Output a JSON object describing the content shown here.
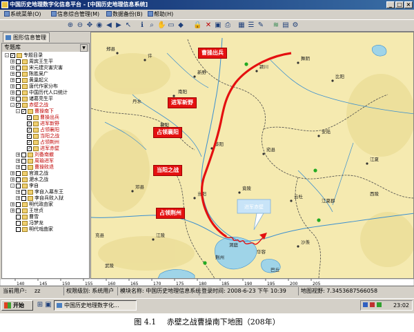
{
  "window": {
    "title": "中国历史地理数字化信息平台 - [中国历史地理信息系统]",
    "controls": [
      "_",
      "□",
      "×"
    ]
  },
  "menubar": {
    "items": [
      "系统菜单(O)",
      "信息综合管理(M)",
      "数据备份(B)",
      "帮助(H)"
    ]
  },
  "toolbar": {
    "icons": [
      "zoom-in-icon",
      "zoom-out-icon",
      "pan-icon",
      "globe-icon",
      "back-icon",
      "forward-icon",
      "pointer-icon",
      "identify-icon",
      "measure-icon",
      "hand-icon",
      "rectangle-icon",
      "color-icon",
      "delete-icon",
      "save-icon",
      "print-icon",
      "table-icon",
      "list-icon",
      "edit-icon",
      "layers-icon",
      "grid-icon",
      "settings-icon"
    ]
  },
  "tabbar": {
    "active_tab": "图形信息管理"
  },
  "panel": {
    "header": "专题库",
    "tree": [
      {
        "level": 0,
        "label": "专题目录",
        "expand": "-",
        "check": true,
        "red": false
      },
      {
        "level": 1,
        "label": "周宾王生平",
        "expand": "+",
        "check": false,
        "red": false
      },
      {
        "level": 1,
        "label": "宋元建灾害灾害",
        "expand": "+",
        "check": false,
        "red": false
      },
      {
        "level": 1,
        "label": "陈胜吴广",
        "expand": "+",
        "check": false,
        "red": false
      },
      {
        "level": 1,
        "label": "黄巢起义",
        "expand": "+",
        "check": false,
        "red": false
      },
      {
        "level": 1,
        "label": "唐代作家分布",
        "expand": "+",
        "check": false,
        "red": false
      },
      {
        "level": 1,
        "label": "中国历代人口统计",
        "expand": "+",
        "check": false,
        "red": false
      },
      {
        "level": 1,
        "label": "诸葛亮生平",
        "expand": "+",
        "check": false,
        "red": false
      },
      {
        "level": 1,
        "label": "赤壁之战",
        "expand": "-",
        "check": true,
        "red": true
      },
      {
        "level": 2,
        "label": "曹操南下",
        "expand": "-",
        "check": true,
        "red": true
      },
      {
        "level": 3,
        "label": "曹操出兵",
        "expand": "",
        "check": true,
        "red": true
      },
      {
        "level": 3,
        "label": "进军新野",
        "expand": "",
        "check": true,
        "red": true
      },
      {
        "level": 3,
        "label": "占领襄阳",
        "expand": "",
        "check": true,
        "red": true
      },
      {
        "level": 3,
        "label": "当阳之战",
        "expand": "",
        "check": true,
        "red": true
      },
      {
        "level": 3,
        "label": "占领荆州",
        "expand": "",
        "check": true,
        "red": true
      },
      {
        "level": 3,
        "label": "进军赤壁",
        "expand": "",
        "check": true,
        "red": true
      },
      {
        "level": 2,
        "label": "刘备南撤",
        "expand": "+",
        "check": false,
        "red": true
      },
      {
        "level": 2,
        "label": "周瑜进军",
        "expand": "+",
        "check": false,
        "red": true
      },
      {
        "level": 2,
        "label": "曹操败退",
        "expand": "+",
        "check": false,
        "red": true
      },
      {
        "level": 1,
        "label": "官渡之战",
        "expand": "+",
        "check": false,
        "red": false
      },
      {
        "level": 1,
        "label": "淝水之战",
        "expand": "+",
        "check": false,
        "red": false
      },
      {
        "level": 1,
        "label": "李自",
        "expand": "-",
        "check": false,
        "red": false
      },
      {
        "level": 2,
        "label": "李自入幕东王",
        "expand": "+",
        "check": false,
        "red": false
      },
      {
        "level": 2,
        "label": "李自兵败入狱",
        "expand": "+",
        "check": false,
        "red": false
      },
      {
        "level": 1,
        "label": "明代政由家",
        "expand": "+",
        "check": false,
        "red": false
      },
      {
        "level": 1,
        "label": "王世贞",
        "expand": "+",
        "check": false,
        "red": false
      },
      {
        "level": 1,
        "label": "曹雪",
        "expand": "",
        "check": false,
        "red": false
      },
      {
        "level": 1,
        "label": "冯梦龙",
        "expand": "",
        "check": false,
        "red": false
      },
      {
        "level": 1,
        "label": "明代戏曲家",
        "expand": "",
        "check": false,
        "red": false
      }
    ]
  },
  "map": {
    "highlights": [
      "曹操出兵",
      "进军新野",
      "占领襄阳",
      "当阳之战",
      "占领荆州"
    ],
    "blue_label": "进军赤壁",
    "city_labels": [
      "郑县",
      "许",
      "颍川",
      "南阳",
      "新野",
      "襄阳",
      "当阳",
      "荆州",
      "江陵",
      "江夏郡",
      "舞阴",
      "比阳",
      "宛县",
      "邓县",
      "安陆",
      "竟陵",
      "华容",
      "巴丘",
      "丹水",
      "武陵",
      "云杜",
      "蔡阳",
      "江夏",
      "沙羡",
      "西陵",
      "洞庭",
      "充县"
    ],
    "colors": {
      "land": "#f5eab0",
      "water": "#9fd4e8",
      "river": "#3a8fd0",
      "route": "#e41010",
      "border": "#4a4a4a"
    }
  },
  "ruler": {
    "ticks": [
      "140",
      "145",
      "150",
      "155",
      "160",
      "165",
      "170",
      "175",
      "180",
      "185",
      "190",
      "195",
      "200",
      "205"
    ]
  },
  "status": {
    "current_user_label": "当前用户:",
    "current_user": "zz",
    "permission": "权限级别: 系统用户",
    "module": "模块名称: 中国历史地理信息系统",
    "login_time": "登录时间: 2008-6-23 下午 10:39",
    "zoom": "地图视野: 7.3453687566058"
  },
  "taskbar": {
    "start": "开始",
    "task": "中国历史地理数字化...",
    "clock": "23:02"
  },
  "caption": {
    "figure": "图 4.1",
    "text": "赤壁之战曹操南下地图（208年）"
  }
}
